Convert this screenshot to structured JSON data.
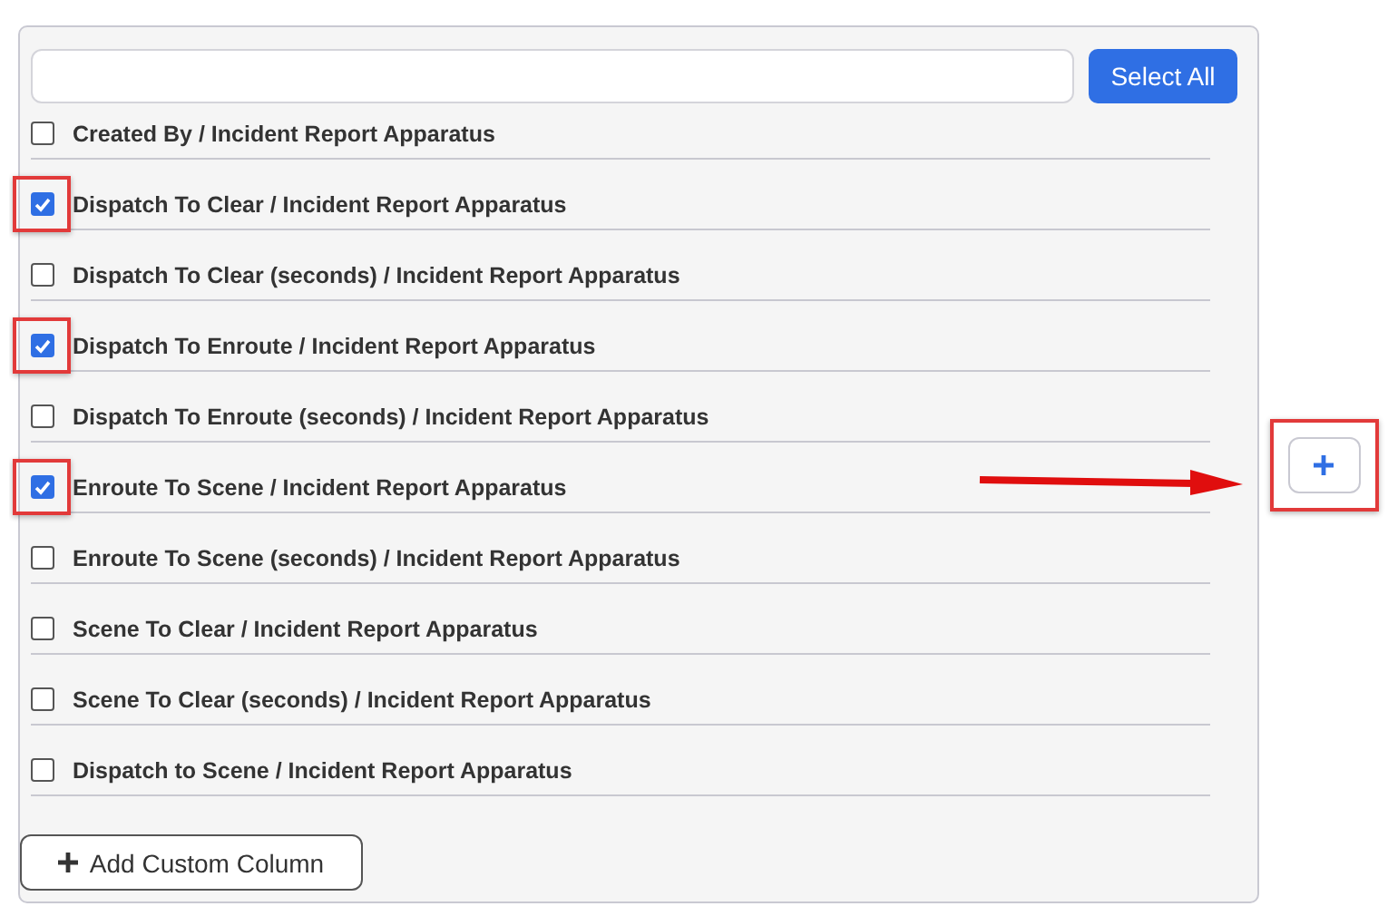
{
  "select_all_button": "Select All",
  "columns": [
    {
      "label": "Created By / Incident Report Apparatus",
      "checked": false,
      "highlighted": false
    },
    {
      "label": "Dispatch To Clear / Incident Report Apparatus",
      "checked": true,
      "highlighted": true
    },
    {
      "label": "Dispatch To Clear (seconds) / Incident Report Apparatus",
      "checked": false,
      "highlighted": false
    },
    {
      "label": "Dispatch To Enroute / Incident Report Apparatus",
      "checked": true,
      "highlighted": true
    },
    {
      "label": "Dispatch To Enroute (seconds) / Incident Report Apparatus",
      "checked": false,
      "highlighted": false
    },
    {
      "label": "Enroute To Scene / Incident Report Apparatus",
      "checked": true,
      "highlighted": true
    },
    {
      "label": "Enroute To Scene (seconds) / Incident Report Apparatus",
      "checked": false,
      "highlighted": false
    },
    {
      "label": "Scene To Clear / Incident Report Apparatus",
      "checked": false,
      "highlighted": false
    },
    {
      "label": "Scene To Clear (seconds) / Incident Report Apparatus",
      "checked": false,
      "highlighted": false
    },
    {
      "label": "Dispatch to Scene / Incident Report Apparatus",
      "checked": false,
      "highlighted": false
    }
  ],
  "add_custom_column_button": "Add Custom Column",
  "add_button": {
    "highlighted": true
  }
}
